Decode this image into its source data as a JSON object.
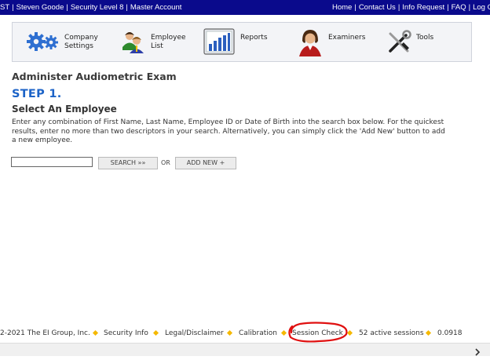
{
  "topbar": {
    "left_items": [
      "ST",
      "Steven Goode",
      "Security Level 8",
      "Master Account"
    ],
    "right_links": [
      "Home",
      "Contact Us",
      "Info Request",
      "FAQ",
      "Log O"
    ],
    "separator": "|"
  },
  "nav": {
    "items": [
      {
        "line1": "Company",
        "line2": "Settings",
        "icon": "gears-icon"
      },
      {
        "line1": "Employee",
        "line2": "List",
        "icon": "people-icon"
      },
      {
        "line1": "Reports",
        "line2": "",
        "icon": "bar-chart-icon"
      },
      {
        "line1": "Examiners",
        "line2": "",
        "icon": "examiner-icon"
      },
      {
        "line1": "Tools",
        "line2": "",
        "icon": "tools-icon"
      }
    ]
  },
  "main": {
    "title": "Administer Audiometric Exam",
    "step": "STEP 1.",
    "select_heading": "Select An Employee",
    "instructions": [
      "Enter any combination of First Name, Last Name, Employee ID or Date of Birth into the search box below. For the quickest",
      "results, enter no more than two descriptors in your search. Alternatively, you can simply click the 'Add New' button to add",
      "a new employee."
    ],
    "search_value": "",
    "search_button": "SEARCH »»",
    "or": "OR",
    "add_new_button": "ADD NEW +"
  },
  "footer": {
    "copyright": "2-2021 The EI Group, Inc.",
    "links": [
      "Security Info",
      "Legal/Disclaimer",
      "Calibration",
      "Session Check"
    ],
    "active_sessions": "52 active sessions",
    "version": "0.0918"
  },
  "colors": {
    "topbar": "#0a0a8c",
    "step": "#1c63c7",
    "diamond": "#f5b800",
    "annotation": "#e01010"
  }
}
